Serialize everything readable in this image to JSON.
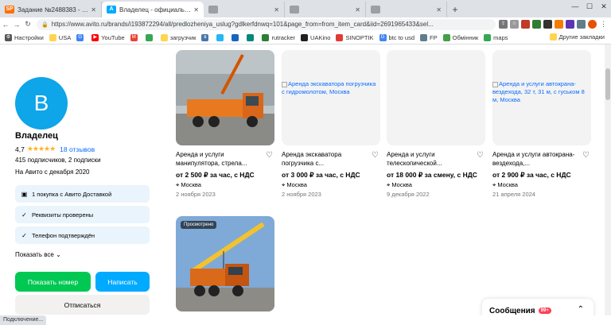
{
  "browser": {
    "tabs": [
      {
        "label": "Задание №2488383 - просмотр з",
        "color": "#ff6f00",
        "fav": "SP"
      },
      {
        "label": "Владелец - официальная страни",
        "color": "#00aaff",
        "fav": "A"
      },
      {
        "label": "",
        "color": "#999999",
        "fav": ""
      },
      {
        "label": "",
        "color": "#999999",
        "fav": ""
      },
      {
        "label": "",
        "color": "#999999",
        "fav": ""
      }
    ],
    "url": "https://www.avito.ru/brands/i193872294/all/predlozheniya_uslug?gdlkerfdnwq=101&page_from=from_item_card&iid=2691965433&sel...",
    "bookmarks": [
      "Настройки",
      "USA",
      "",
      "YouTube",
      "",
      "",
      "загрузчик",
      "",
      "",
      "",
      "",
      "rutracker",
      "UAKino",
      "SINOPTIK",
      "btc to usd",
      "FP",
      "Обмінник",
      "maps"
    ],
    "bookmarks_right": "Другие закладки"
  },
  "seller": {
    "avatar_letter": "В",
    "name": "Владелец",
    "rating": "4,7",
    "stars": "★★★★★",
    "reviews": "18 отзывов",
    "subs": "415 подписчиков, 2 подписки",
    "since": "На Авито с декабря 2020",
    "badges": [
      "1 покупка с Авито Доставкой",
      "Реквизиты проверены",
      "Телефон подтверждён"
    ],
    "show_all": "Показать все",
    "btn_phone": "Показать номер",
    "btn_write": "Написать",
    "btn_unsub": "Отписаться"
  },
  "listings": [
    {
      "title": "Аренда и услуги манипулятора, стрела...",
      "price": "от 2 500 ₽ за час, с НДС",
      "location": "Москва",
      "date": "2 ноября 2023",
      "alt": "",
      "viewed": ""
    },
    {
      "title": "Аренда экскаватора погрузчика с...",
      "price": "от 3 000 ₽ за час, с НДС",
      "location": "Москва",
      "date": "2 ноября 2023",
      "alt": "Аренда экскаватора погрузчика с гидромолотом, Москва",
      "viewed": ""
    },
    {
      "title": "Аренда и услуги телескопической...",
      "price": "от 18 000 ₽ за смену, с НДС",
      "location": "Москва",
      "date": "9 декабря 2022",
      "alt": "",
      "viewed": ""
    },
    {
      "title": "Аренда и услуги автокрана-вездехода,...",
      "price": "от 2 900 ₽ за час, с НДС",
      "location": "Москва",
      "date": "21 апреля 2024",
      "alt": "Аренда и услуги автокрана-вездехода, 32 т, 31 м, с гуськом 8 м, Москва",
      "viewed": ""
    },
    {
      "title": "",
      "price": "",
      "location": "",
      "date": "",
      "alt": "",
      "viewed": "Просмотрено"
    }
  ],
  "messages": {
    "label": "Сообщения",
    "count": "99+"
  },
  "status": "Подключение..."
}
